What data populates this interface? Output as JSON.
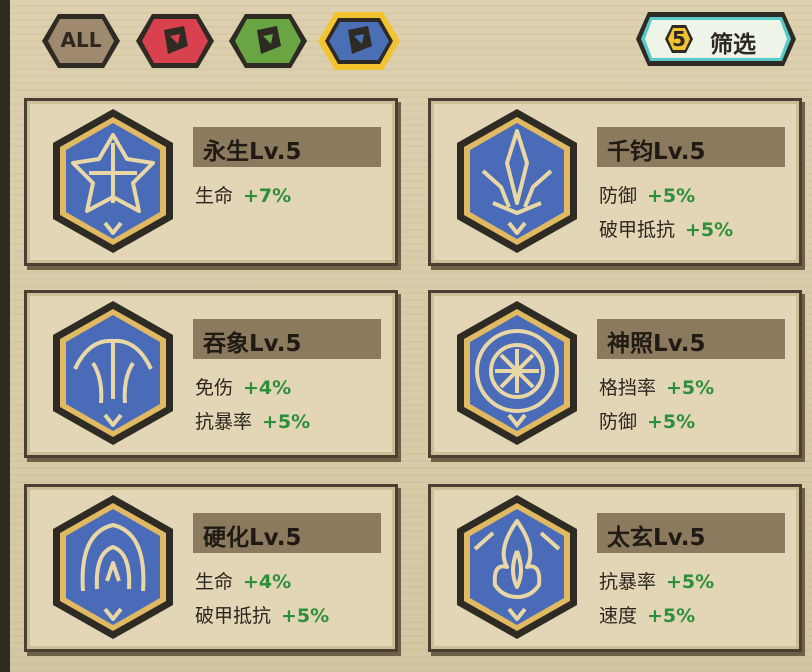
{
  "filters": {
    "all_label": "ALL",
    "colors": {
      "red": "#d9414e",
      "green": "#6aa543",
      "blue": "#4b6fb5",
      "all": "#a08a6f"
    },
    "selected": "blue",
    "filter_button": {
      "count": "5",
      "label": "筛选"
    }
  },
  "cards": [
    {
      "name": "永生Lv.5",
      "icon": "spiked-star-icon",
      "stats": [
        {
          "label": "生命",
          "value": "+7%"
        }
      ]
    },
    {
      "name": "千钧Lv.5",
      "icon": "trident-icon",
      "stats": [
        {
          "label": "防御",
          "value": "+5%"
        },
        {
          "label": "破甲抵抗",
          "value": "+5%"
        }
      ]
    },
    {
      "name": "吞象Lv.5",
      "icon": "elephant-head-icon",
      "stats": [
        {
          "label": "免伤",
          "value": "+4%"
        },
        {
          "label": "抗暴率",
          "value": "+5%"
        }
      ]
    },
    {
      "name": "神照Lv.5",
      "icon": "radiant-wheel-icon",
      "stats": [
        {
          "label": "格挡率",
          "value": "+5%"
        },
        {
          "label": "防御",
          "value": "+5%"
        }
      ]
    },
    {
      "name": "硬化Lv.5",
      "icon": "hooded-figure-icon",
      "stats": [
        {
          "label": "生命",
          "value": "+4%"
        },
        {
          "label": "破甲抵抗",
          "value": "+5%"
        }
      ]
    },
    {
      "name": "太玄Lv.5",
      "icon": "flame-icon",
      "stats": [
        {
          "label": "抗暴率",
          "value": "+5%"
        },
        {
          "label": "速度",
          "value": "+5%"
        }
      ]
    }
  ]
}
